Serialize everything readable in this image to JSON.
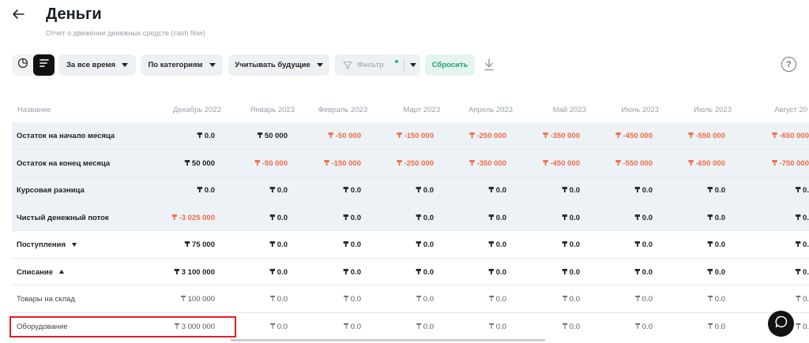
{
  "header": {
    "title": "Деньги",
    "subtitle": "Отчет о движении денежных средств (cash flow)"
  },
  "toolbar": {
    "period_label": "За все время",
    "grouping_label": "По категориям",
    "future_label": "Учитывать будущие",
    "filter_label": "Фильтр",
    "reset_label": "Сбросить",
    "help_label": "?"
  },
  "table": {
    "name_header": "Название",
    "months": [
      "Декабрь 2022",
      "Январь 2023",
      "Февраль 2023",
      "Март 2023",
      "Апрель 2023",
      "Май 2023",
      "Июнь 2023",
      "Июль 2023",
      "Август 20"
    ],
    "rows": [
      {
        "name": "Остаток на начало месяца",
        "cells": [
          "₸ 0.0",
          "₸ 50 000",
          "₸ -50 000",
          "₸ -150 000",
          "₸ -250 000",
          "₸ -350 000",
          "₸ -450 000",
          "₸ -550 000",
          "₸ -650 000"
        ]
      },
      {
        "name": "Остаток на конец месяца",
        "cells": [
          "₸ 50 000",
          "₸ -50 000",
          "₸ -150 000",
          "₸ -250 000",
          "₸ -350 000",
          "₸ -450 000",
          "₸ -550 000",
          "₸ -650 000",
          "₸ -750 000"
        ]
      },
      {
        "name": "Курсовая разница",
        "cells": [
          "₸ 0.0",
          "₸ 0.0",
          "₸ 0.0",
          "₸ 0.0",
          "₸ 0.0",
          "₸ 0.0",
          "₸ 0.0",
          "₸ 0.0",
          "₸ 0."
        ]
      },
      {
        "name": "Чистый денежный поток",
        "cells": [
          "₸ -3 025 000",
          "₸ 0.0",
          "₸ 0.0",
          "₸ 0.0",
          "₸ 0.0",
          "₸ 0.0",
          "₸ 0.0",
          "₸ 0.0",
          "₸ 0."
        ]
      },
      {
        "name": "Поступления",
        "cells": [
          "₸ 75 000",
          "₸ 0.0",
          "₸ 0.0",
          "₸ 0.0",
          "₸ 0.0",
          "₸ 0.0",
          "₸ 0.0",
          "₸ 0.0",
          "₸ 0."
        ]
      },
      {
        "name": "Списание",
        "cells": [
          "₸ 3 100 000",
          "₸ 0.0",
          "₸ 0.0",
          "₸ 0.0",
          "₸ 0.0",
          "₸ 0.0",
          "₸ 0.0",
          "₸ 0.0",
          "₸ 0."
        ]
      },
      {
        "name": "Товары на склад",
        "cells": [
          "₸ 100 000",
          "₸ 0.0",
          "₸ 0.0",
          "₸ 0.0",
          "₸ 0.0",
          "₸ 0.0",
          "₸ 0.0",
          "₸ 0.0",
          "₸ 0."
        ]
      },
      {
        "name": "Оборудование",
        "cells": [
          "₸ 3 000 000",
          "₸ 0.0",
          "₸ 0.0",
          "₸ 0.0",
          "₸ 0.0",
          "₸ 0.0",
          "₸ 0.0",
          "₸ 0.0",
          "₸ 0."
        ]
      }
    ]
  },
  "icons": {
    "back": "arrow-left-icon",
    "view_chart": "clock-chart-icon",
    "view_list": "list-lines-icon",
    "filter": "funnel-icon",
    "download": "download-icon",
    "help": "question-icon",
    "chat": "chat-bubble-icon"
  },
  "colors": {
    "negative": "#ef6b45",
    "accent_green": "#21a07a",
    "row_shade": "#edf2f6",
    "highlight_red": "#e51e25"
  }
}
